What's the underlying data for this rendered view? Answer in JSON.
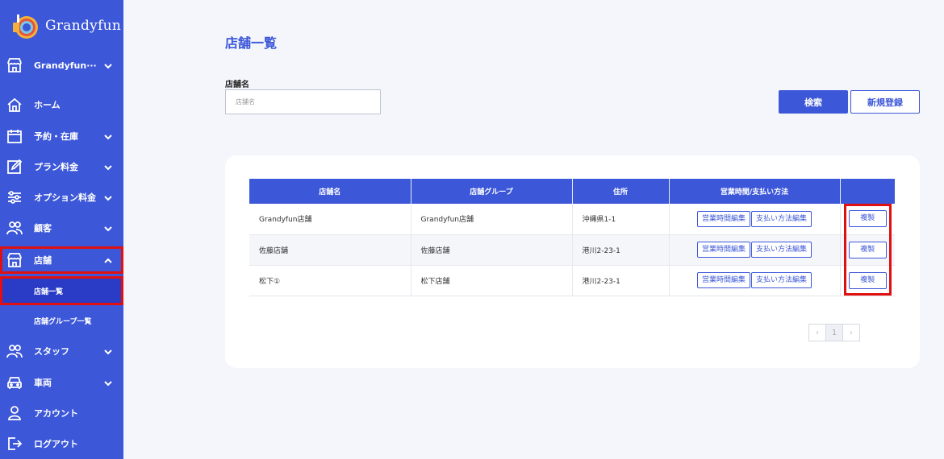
{
  "app": {
    "name": "Grandyfun"
  },
  "sidebar": {
    "account": "Grandyfun···",
    "items": [
      {
        "label": "ホーム",
        "icon": "home-icon"
      },
      {
        "label": "予約・在庫",
        "icon": "calendar-icon"
      },
      {
        "label": "プラン料金",
        "icon": "edit-icon"
      },
      {
        "label": "オプション料金",
        "icon": "sliders-icon"
      },
      {
        "label": "顧客",
        "icon": "users-icon"
      },
      {
        "label": "店舗",
        "icon": "store-icon"
      },
      {
        "label": "スタッフ",
        "icon": "staff-icon"
      },
      {
        "label": "車両",
        "icon": "car-icon"
      },
      {
        "label": "アカウント",
        "icon": "user-icon"
      },
      {
        "label": "ログアウト",
        "icon": "logout-icon"
      }
    ],
    "sub_items": [
      {
        "label": "店舗一覧"
      },
      {
        "label": "店舗グループ一覧"
      }
    ]
  },
  "main": {
    "title": "店舗一覧",
    "filter": {
      "label": "店舗名",
      "placeholder": "店舗名"
    },
    "search_label": "検索",
    "new_label": "新規登録",
    "table": {
      "headers": [
        "店舗名",
        "店舗グループ",
        "住所",
        "営業時間/支払い方法",
        ""
      ],
      "hours_label": "営業時間編集",
      "payment_label": "支払い方法編集",
      "copy_label": "複製",
      "rows": [
        {
          "name": "Grandyfun店舗",
          "group": "Grandyfun店舗",
          "address": "沖縄県1-1"
        },
        {
          "name": "佐藤店舗",
          "group": "佐藤店舗",
          "address": "港川2-23-1"
        },
        {
          "name": "松下①",
          "group": "松下店舗",
          "address": "港川2-23-1"
        }
      ]
    },
    "pagination": {
      "prev": "‹",
      "current": "1",
      "next": "›"
    }
  },
  "colors": {
    "primary": "#3c57d8",
    "highlight": "#e01010",
    "sidebar_active": "#2a3cc6"
  }
}
